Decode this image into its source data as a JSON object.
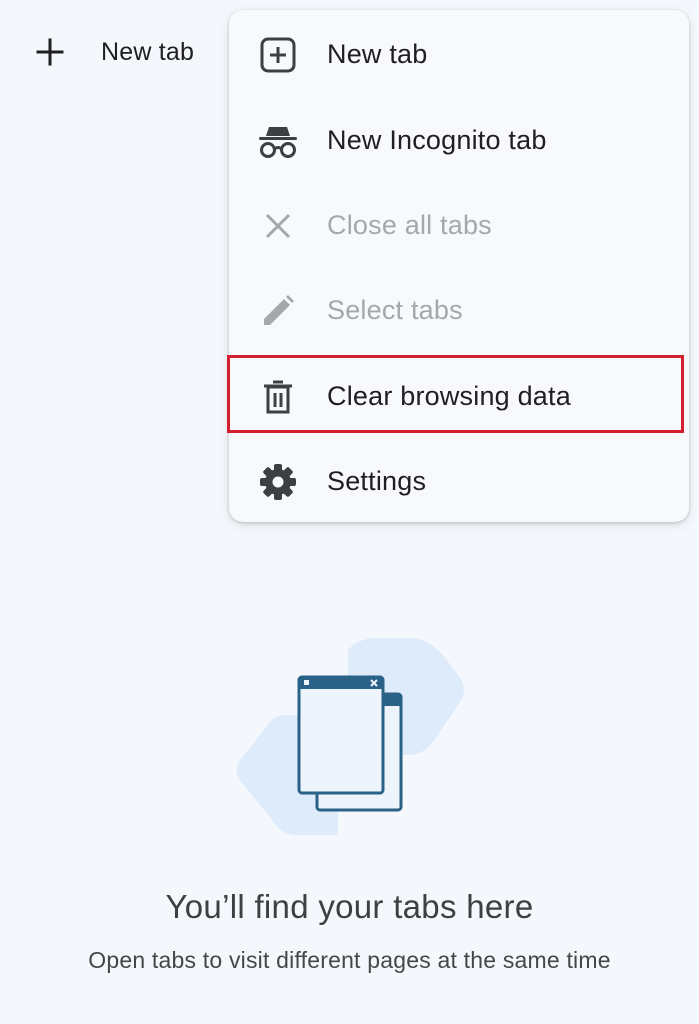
{
  "toolbar": {
    "new_tab_label": "New tab",
    "plus_icon": "plus-icon"
  },
  "menu": {
    "items": [
      {
        "label": "New tab",
        "icon": "new-tab-icon",
        "enabled": true
      },
      {
        "label": "New Incognito tab",
        "icon": "incognito-icon",
        "enabled": true
      },
      {
        "label": "Close all tabs",
        "icon": "close-icon",
        "enabled": false
      },
      {
        "label": "Select tabs",
        "icon": "pencil-icon",
        "enabled": false
      },
      {
        "label": "Clear browsing data",
        "icon": "trash-icon",
        "enabled": true,
        "highlighted": true
      },
      {
        "label": "Settings",
        "icon": "gear-icon",
        "enabled": true
      }
    ]
  },
  "empty_state": {
    "title": "You’ll find your tabs here",
    "subtitle": "Open tabs to visit different pages at the same time",
    "illustration": "tabs-illustration"
  },
  "colors": {
    "background": "#f4f7fc",
    "menu_background": "#f7f9fd",
    "highlight_border": "#d41f2f",
    "disabled_text": "#a4a7ab",
    "illustration_stroke": "#2a6186"
  }
}
